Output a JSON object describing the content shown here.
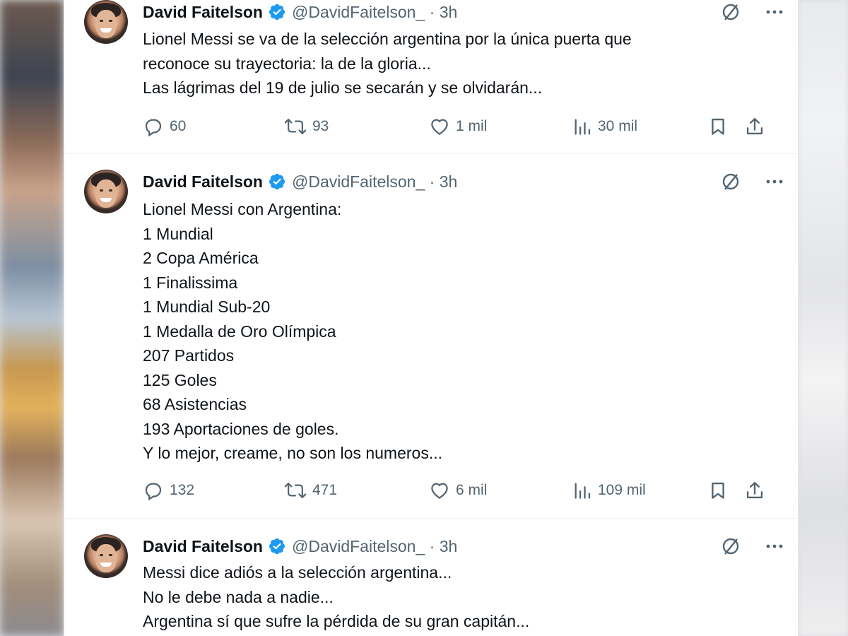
{
  "tweets": [
    {
      "author_name": "David Faitelson",
      "handle_time": "@DavidFaitelson_ · 3h",
      "lines": [
        "Lionel Messi se va de la selección argentina por la única puerta que",
        "reconoce su trayectoria: la de la gloria...",
        "Las lágrimas del 19 de julio se secarán y se olvidarán..."
      ],
      "replies": "60",
      "retweets": "93",
      "likes": "1 mil",
      "views": "30 mil"
    },
    {
      "author_name": "David Faitelson",
      "handle_time": "@DavidFaitelson_ · 3h",
      "lines": [
        "Lionel Messi con Argentina:",
        "1 Mundial",
        "2 Copa América",
        "1 Finalissima",
        "1 Mundial Sub-20",
        "1 Medalla de Oro Olímpica",
        "207 Partidos",
        "125 Goles",
        "68 Asistencias",
        "193 Aportaciones de goles.",
        "Y lo mejor, creame, no son los numeros..."
      ],
      "replies": "132",
      "retweets": "471",
      "likes": "6 mil",
      "views": "109 mil"
    },
    {
      "author_name": "David Faitelson",
      "handle_time": "@DavidFaitelson_ · 3h",
      "lines": [
        "Messi dice adiós a la selección argentina...",
        "No le debe nada a nadie...",
        "Argentina sí que sufre la pérdida de su gran capitán..."
      ]
    }
  ],
  "icons": {
    "verified": "verified-badge-icon",
    "grok": "slashed-circle-icon",
    "more": "more-dots-icon",
    "reply": "reply-bubble-icon",
    "retweet": "retweet-icon",
    "like": "heart-icon",
    "views": "views-chart-icon",
    "bookmark": "bookmark-icon",
    "share": "share-icon"
  },
  "colors": {
    "verified": "#1d9bf0",
    "text": "#0f1419",
    "secondary": "#536471"
  }
}
